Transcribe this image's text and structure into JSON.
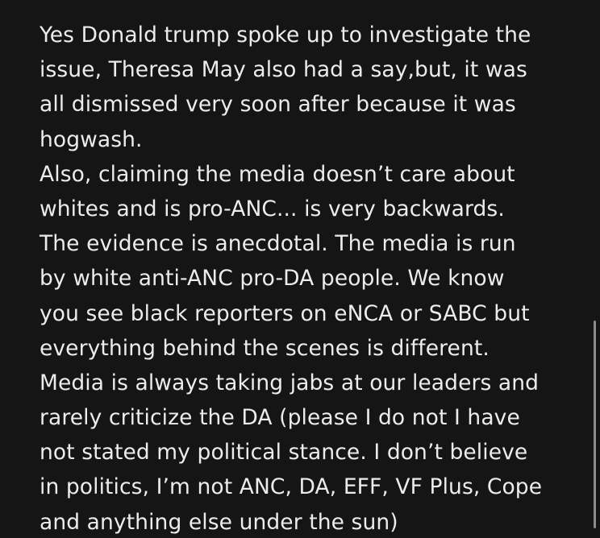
{
  "note": {
    "lines": [
      "Yes Donald trump spoke up to investigate the",
      "issue, Theresa May also had a say,but, it was",
      "all dismissed very soon after because it was",
      "hogwash.",
      "Also, claiming the media doesn’t care about",
      "whites and is pro-ANC... is very backwards.",
      "The evidence is anecdotal.  The media is run",
      "by white anti-ANC pro-DA people.  We know",
      "you see black reporters on eNCA or SABC but",
      "everything behind the scenes is different.",
      "Media is always taking jabs at our leaders and",
      "rarely criticize the DA (please I do not I have",
      "not stated my political stance.  I don’t believe",
      "in politics, I’m not ANC, DA, EFF, VF Plus, Cope",
      "and anything else under the sun)"
    ]
  },
  "colors": {
    "background": "#151515",
    "text": "#ececec",
    "scrollbar": "#8c8c8c"
  }
}
